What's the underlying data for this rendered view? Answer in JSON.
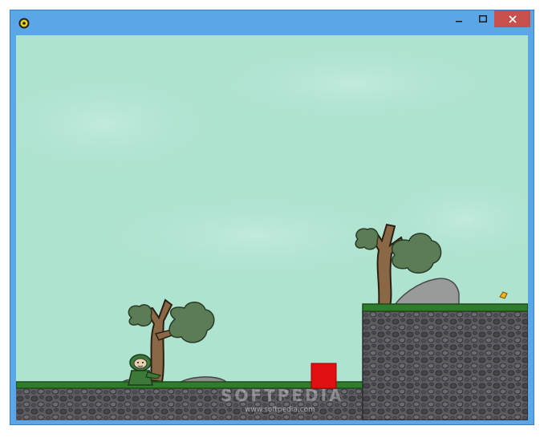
{
  "window": {
    "app_icon": "gear-icon",
    "controls": {
      "minimize_icon": "minimize-icon",
      "maximize_icon": "maximize-icon",
      "close_icon": "close-icon"
    }
  },
  "game": {
    "player": "green-ninja-player",
    "enemy": "red-block",
    "pickup": "gold-coin",
    "colors": {
      "sky": "#aee3d0",
      "grass": "#2f7d2a",
      "rock": "#5a5a5e",
      "enemy": "#e01010"
    }
  },
  "watermark": {
    "brand": "SOFTPEDIA",
    "url": "www.softpedia.com"
  }
}
